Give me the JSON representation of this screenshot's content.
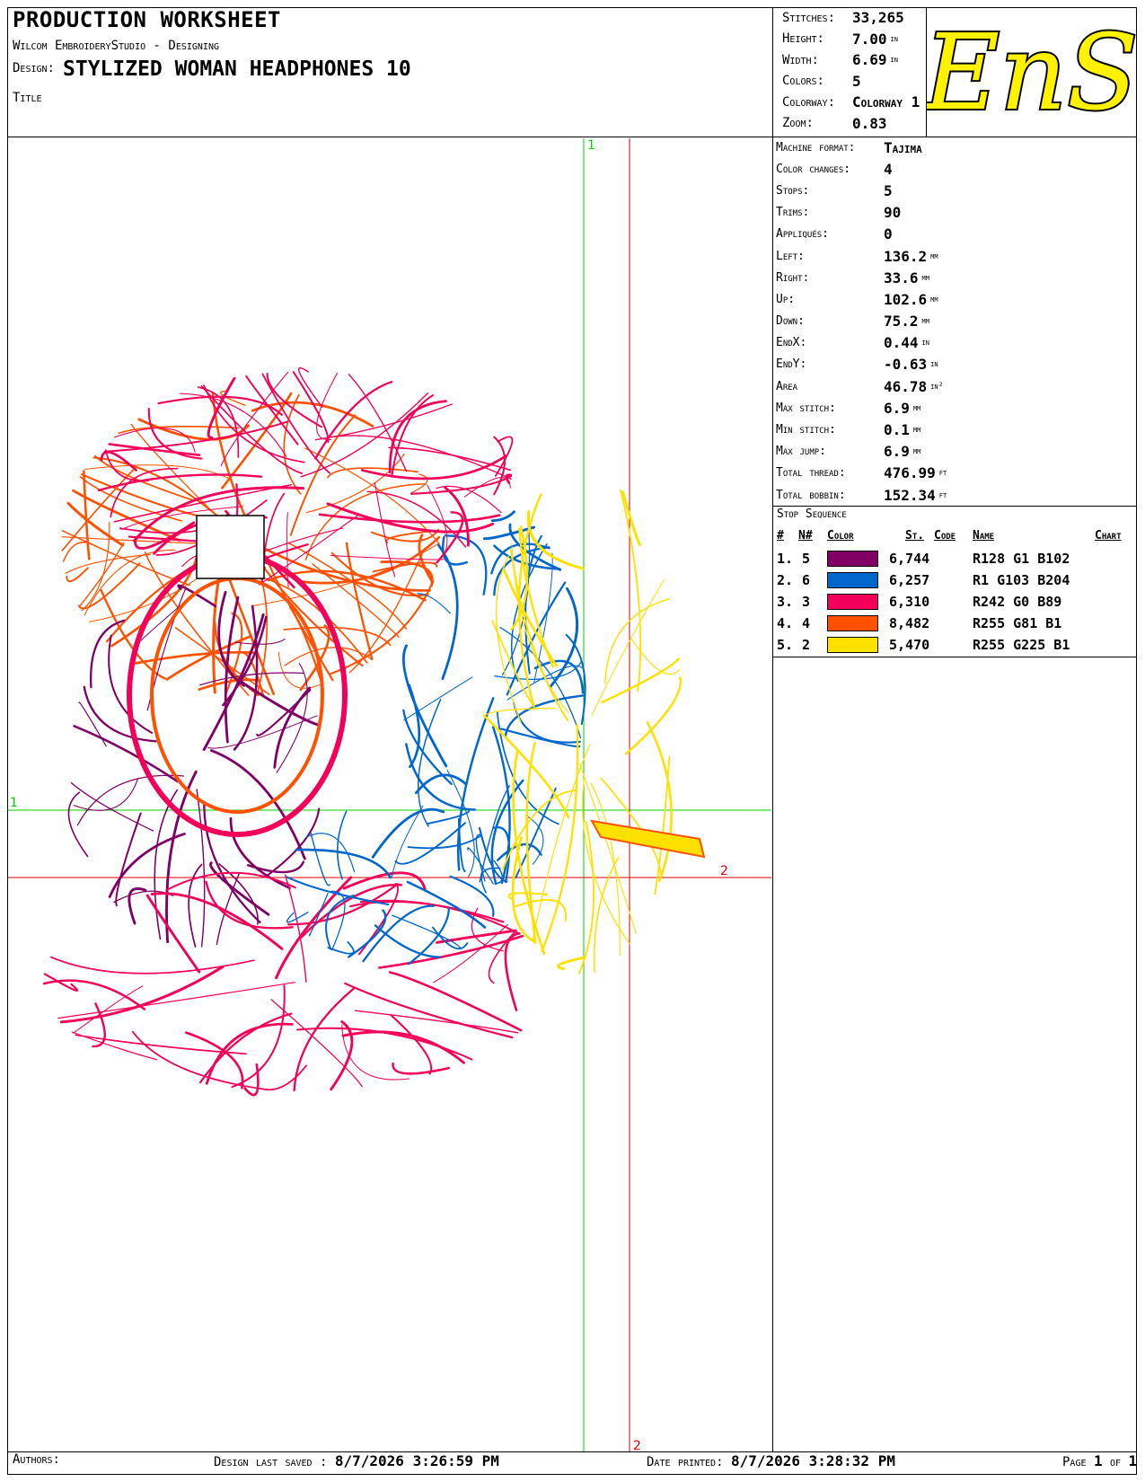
{
  "header": {
    "title": "PRODUCTION WORKSHEET",
    "software": "Wilcom EmbroideryStudio - Designing",
    "design_label": "Design:",
    "design_name": "STYLIZED WOMAN HEADPHONES 10",
    "title_label": "Title"
  },
  "summary": [
    {
      "label": "Stitches:",
      "value": "33,265",
      "unit": ""
    },
    {
      "label": "Height:",
      "value": "7.00",
      "unit": "in"
    },
    {
      "label": "Width:",
      "value": "6.69",
      "unit": "in"
    },
    {
      "label": "Colors:",
      "value": "5",
      "unit": ""
    },
    {
      "label": "Colorway:",
      "value": "Colorway 1",
      "unit": ""
    },
    {
      "label": "Zoom:",
      "value": "0.83",
      "unit": ""
    }
  ],
  "logo": {
    "text": "EnS",
    "fill": "#fff200",
    "stroke": "#000000"
  },
  "stats": [
    {
      "label": "Machine format:",
      "value": "Tajima",
      "unit": ""
    },
    {
      "label": "Color changes:",
      "value": "4",
      "unit": ""
    },
    {
      "label": "Stops:",
      "value": "5",
      "unit": ""
    },
    {
      "label": "Trims:",
      "value": "90",
      "unit": ""
    },
    {
      "label": "Appliqués:",
      "value": "0",
      "unit": ""
    },
    {
      "label": "Left:",
      "value": "136.2",
      "unit": "mm"
    },
    {
      "label": "Right:",
      "value": "33.6",
      "unit": "mm"
    },
    {
      "label": "Up:",
      "value": "102.6",
      "unit": "mm"
    },
    {
      "label": "Down:",
      "value": "75.2",
      "unit": "mm"
    },
    {
      "label": "EndX:",
      "value": "0.44",
      "unit": "in"
    },
    {
      "label": "EndY:",
      "value": "-0.63",
      "unit": "in"
    },
    {
      "label": "Area",
      "value": "46.78",
      "unit": "in²"
    },
    {
      "label": "Max stitch:",
      "value": "6.9",
      "unit": "mm"
    },
    {
      "label": "Min stitch:",
      "value": "0.1",
      "unit": "mm"
    },
    {
      "label": "Max jump:",
      "value": "6.9",
      "unit": "mm"
    },
    {
      "label": "Total thread:",
      "value": "476.99",
      "unit": "ft"
    },
    {
      "label": "Total bobbin:",
      "value": "152.34",
      "unit": "ft"
    }
  ],
  "stop_sequence": {
    "title": "Stop Sequence",
    "columns": [
      "#",
      "N#",
      "Color",
      "St.",
      "Code",
      "Name",
      "Chart"
    ],
    "rows": [
      {
        "num": "1.",
        "needle": "5",
        "color": "#800066",
        "stitches": "6,744",
        "name": "R128 G1 B102"
      },
      {
        "num": "2.",
        "needle": "6",
        "color": "#0167cc",
        "stitches": "6,257",
        "name": "R1 G103 B204"
      },
      {
        "num": "3.",
        "needle": "3",
        "color": "#f20059",
        "stitches": "6,310",
        "name": "R242 G0 B89"
      },
      {
        "num": "4.",
        "needle": "4",
        "color": "#ff5101",
        "stitches": "8,482",
        "name": "R255 G81 B1"
      },
      {
        "num": "5.",
        "needle": "2",
        "color": "#ffe101",
        "stitches": "5,470",
        "name": "R255 G225 B1"
      }
    ]
  },
  "footer": {
    "authors_label": "Authors:",
    "saved_label": "Design last saved :",
    "saved_value": "8/7/2026 3:26:59 PM",
    "printed_label": "Date printed:",
    "printed_value": "8/7/2026 3:28:32 PM",
    "page_label_1": "Page",
    "page_current": "1",
    "page_label_2": "of",
    "page_total": "1"
  },
  "guides": {
    "green_label": "1",
    "red_label": "2",
    "green_color": "#00d000",
    "red_color": "#e00000"
  }
}
